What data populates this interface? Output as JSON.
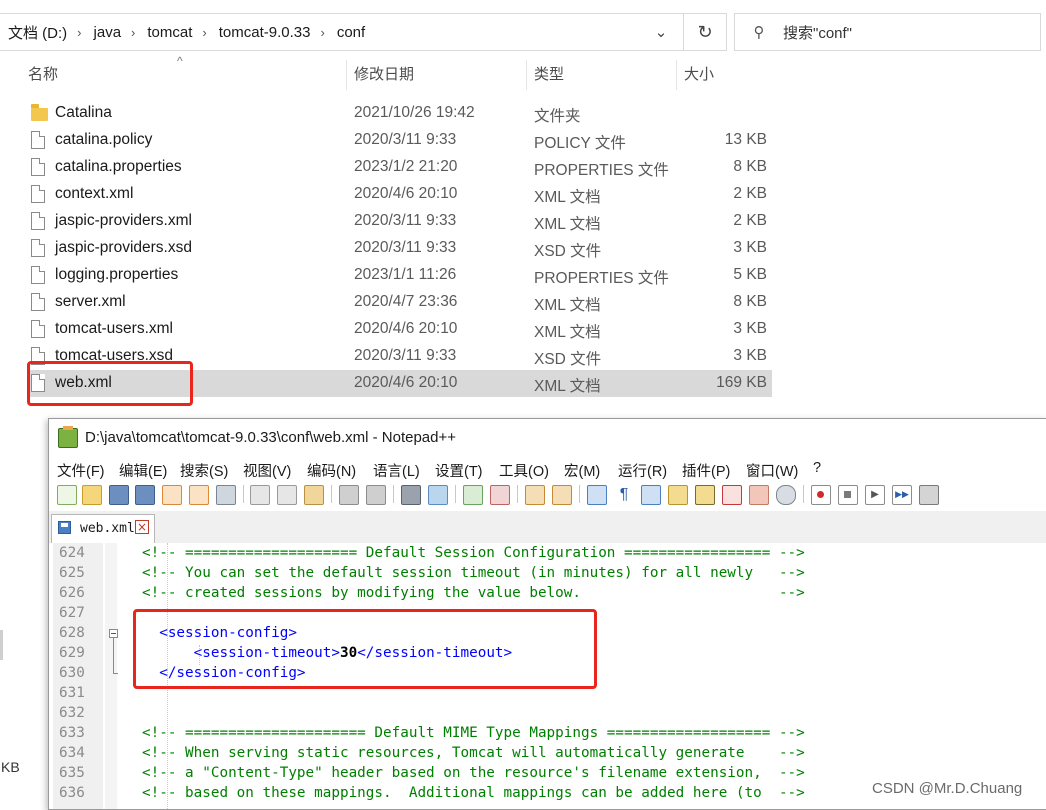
{
  "explorer": {
    "breadcrumb": [
      "文档 (D:)",
      "java",
      "tomcat",
      "tomcat-9.0.33",
      "conf"
    ],
    "search_placeholder": "搜索\"conf\"",
    "columns": {
      "name": "名称",
      "date": "修改日期",
      "type": "类型",
      "size": "大小"
    },
    "files": [
      {
        "name": "Catalina",
        "date": "2021/10/26 19:42",
        "type": "文件夹",
        "size": "",
        "kind": "folder"
      },
      {
        "name": "catalina.policy",
        "date": "2020/3/11 9:33",
        "type": "POLICY 文件",
        "size": "13 KB",
        "kind": "file"
      },
      {
        "name": "catalina.properties",
        "date": "2023/1/2 21:20",
        "type": "PROPERTIES 文件",
        "size": "8 KB",
        "kind": "file"
      },
      {
        "name": "context.xml",
        "date": "2020/4/6 20:10",
        "type": "XML 文档",
        "size": "2 KB",
        "kind": "file"
      },
      {
        "name": "jaspic-providers.xml",
        "date": "2020/3/11 9:33",
        "type": "XML 文档",
        "size": "2 KB",
        "kind": "file"
      },
      {
        "name": "jaspic-providers.xsd",
        "date": "2020/3/11 9:33",
        "type": "XSD 文件",
        "size": "3 KB",
        "kind": "file"
      },
      {
        "name": "logging.properties",
        "date": "2023/1/1 11:26",
        "type": "PROPERTIES 文件",
        "size": "5 KB",
        "kind": "file"
      },
      {
        "name": "server.xml",
        "date": "2020/4/7 23:36",
        "type": "XML 文档",
        "size": "8 KB",
        "kind": "file"
      },
      {
        "name": "tomcat-users.xml",
        "date": "2020/4/6 20:10",
        "type": "XML 文档",
        "size": "3 KB",
        "kind": "file"
      },
      {
        "name": "tomcat-users.xsd",
        "date": "2020/3/11 9:33",
        "type": "XSD 文件",
        "size": "3 KB",
        "kind": "file"
      },
      {
        "name": "web.xml",
        "date": "2020/4/6 20:10",
        "type": "XML 文档",
        "size": "169 KB",
        "kind": "file",
        "selected": true
      }
    ],
    "left_clip_text": "KB"
  },
  "notepad": {
    "title": "D:\\java\\tomcat\\tomcat-9.0.33\\conf\\web.xml - Notepad++",
    "menu": [
      "文件(F)",
      "编辑(E)",
      "搜索(S)",
      "视图(V)",
      "编码(N)",
      "语言(L)",
      "设置(T)",
      "工具(O)",
      "宏(M)",
      "运行(R)",
      "插件(P)",
      "窗口(W)",
      "?"
    ],
    "tab_label": "web.xml",
    "lines": [
      {
        "num": "624",
        "text": "<!-- ==================== Default Session Configuration ================= -->",
        "kind": "comment"
      },
      {
        "num": "625",
        "text": "<!-- You can set the default session timeout (in minutes) for all newly   -->",
        "kind": "comment"
      },
      {
        "num": "626",
        "text": "<!-- created sessions by modifying the value below.                       -->",
        "kind": "comment"
      },
      {
        "num": "627",
        "text": "",
        "kind": "blank"
      },
      {
        "num": "628",
        "text": "  <session-config>",
        "kind": "tag"
      },
      {
        "num": "629",
        "open": "      <session-timeout>",
        "value": "30",
        "close": "</session-timeout>",
        "kind": "mixed"
      },
      {
        "num": "630",
        "text": "  </session-config>",
        "kind": "tag"
      },
      {
        "num": "631",
        "text": "",
        "kind": "blank"
      },
      {
        "num": "632",
        "text": "",
        "kind": "blank"
      },
      {
        "num": "633",
        "text": "<!-- ===================== Default MIME Type Mappings =================== -->",
        "kind": "comment"
      },
      {
        "num": "634",
        "text": "<!-- When serving static resources, Tomcat will automatically generate    -->",
        "kind": "comment"
      },
      {
        "num": "635",
        "text": "<!-- a \"Content-Type\" header based on the resource's filename extension,  -->",
        "kind": "comment"
      },
      {
        "num": "636",
        "text": "<!-- based on these mappings.  Additional mappings can be added here (to  -->",
        "kind": "comment"
      }
    ]
  },
  "watermark": "CSDN @Mr.D.Chuang",
  "colors": {
    "highlight": "#e8261b",
    "comment": "#008000",
    "tag": "#0000ff",
    "selection": "#d9d9d9"
  }
}
